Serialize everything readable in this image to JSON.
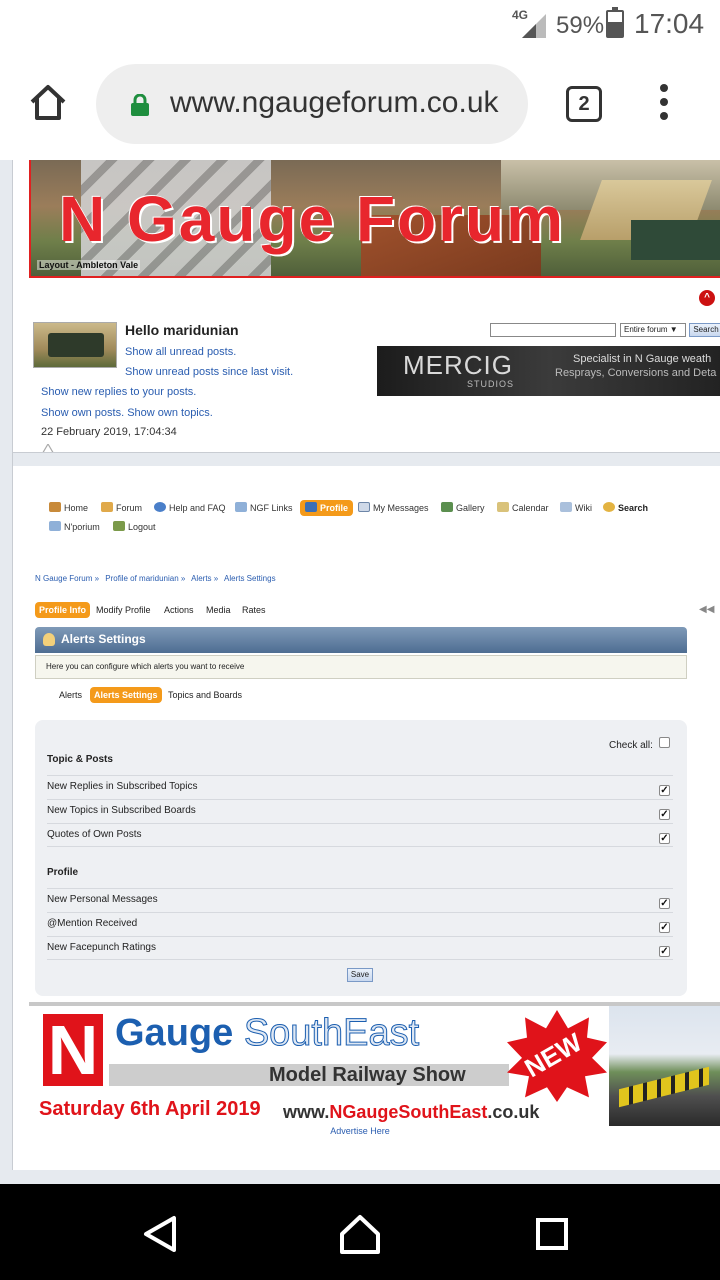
{
  "status_bar": {
    "network": "4G",
    "battery": "59%",
    "battery_level": 0.59,
    "time": "17:04"
  },
  "browser": {
    "url": "www.ngaugeforum.co.uk",
    "tab_count": "2"
  },
  "header": {
    "title": "N Gauge Forum",
    "caption": "Layout - Ambleton Vale"
  },
  "user": {
    "greeting": "Hello maridunian",
    "links": [
      "Show all unread posts.",
      "Show unread posts since last visit.",
      "Show new replies to your posts.",
      "Show own posts. Show own topics."
    ],
    "date": "22 February 2019, 17:04:34"
  },
  "search": {
    "scope": "Entire forum ▼",
    "button": "Search"
  },
  "ad_top": {
    "logo": "MERCIG",
    "sub": "STUDIOS",
    "line1": "Specialist in N Gauge weath",
    "line2": "Resprays, Conversions and Deta"
  },
  "menu": {
    "items": [
      "Home",
      "Forum",
      "Help and FAQ",
      "NGF Links",
      "Profile",
      "My Messages",
      "Gallery",
      "Calendar",
      "Wiki",
      "Search",
      "N'porium",
      "Logout"
    ]
  },
  "breadcrumb": [
    "N Gauge Forum »",
    "Profile of maridunian »",
    "Alerts »",
    "Alerts Settings"
  ],
  "profile_tabs": [
    "Profile Info",
    "Modify Profile",
    "Actions",
    "Media",
    "Rates"
  ],
  "panel": {
    "title": "Alerts Settings",
    "description": "Here you can configure which alerts you want to receive",
    "tabs": [
      "Alerts",
      "Alerts Settings",
      "Topics and Boards"
    ],
    "check_all": "Check all:",
    "sections": [
      {
        "title": "Topic & Posts",
        "rows": [
          {
            "label": "New Replies in Subscribed Topics",
            "checked": true
          },
          {
            "label": "New Topics in Subscribed Boards",
            "checked": true
          },
          {
            "label": "Quotes of Own Posts",
            "checked": true
          }
        ]
      },
      {
        "title": "Profile",
        "rows": [
          {
            "label": "New Personal Messages",
            "checked": true
          },
          {
            "label": "@Mention Received",
            "checked": true
          },
          {
            "label": "New Facepunch Ratings",
            "checked": true
          }
        ]
      }
    ],
    "save": "Save"
  },
  "ad_bottom": {
    "n": "N",
    "gauge": "Gauge",
    "southeast": "SouthEast",
    "show": "Model Railway Show",
    "new": "NEW",
    "date": "Saturday 6th April 2019",
    "url_pre": "www.",
    "url_red": "NGaugeSouthEast",
    "url_post": ".co.uk",
    "advertise": "Advertise Here"
  },
  "colors": {
    "accent_orange": "#f49a1a",
    "link_blue": "#2a5db0",
    "brand_red": "#e8262d"
  }
}
